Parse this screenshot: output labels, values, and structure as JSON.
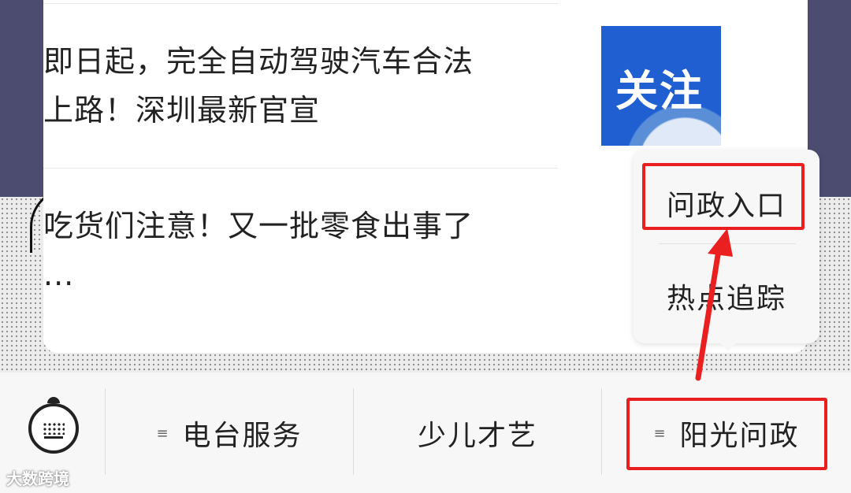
{
  "articles": [
    {
      "title_line1": "即日起，完全自动驾驶汽车合法",
      "title_line2": "上路！深圳最新官宣",
      "thumb_text": "关注"
    },
    {
      "title_line1": "吃货们注意！又一批零食出事了",
      "title_line2": "..."
    }
  ],
  "popup": {
    "items": [
      "问政入口",
      "热点追踪"
    ]
  },
  "tabbar": {
    "tabs": [
      "电台服务",
      "少儿才艺",
      "阳光问政"
    ],
    "menu_glyph": "≡"
  },
  "watermark": "大数跨境",
  "colors": {
    "highlight": "#ea1f1f",
    "thumb_blue": "#1f5fd1"
  }
}
